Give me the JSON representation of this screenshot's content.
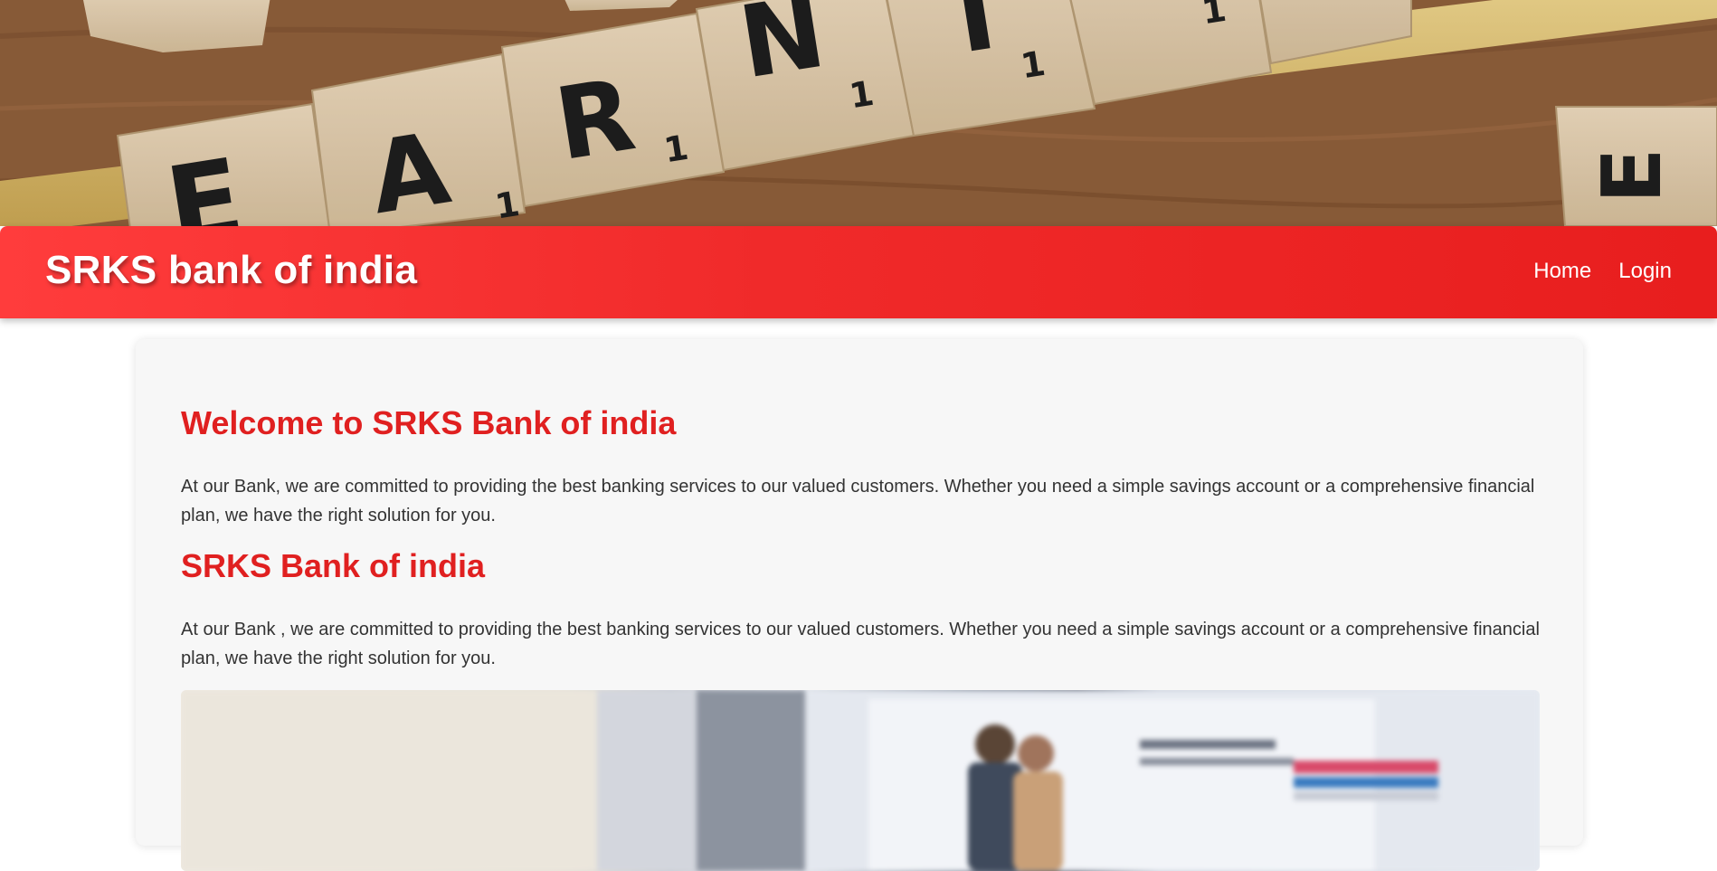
{
  "header": {
    "brand": "SRKS bank of india",
    "nav": [
      {
        "label": "Home"
      },
      {
        "label": "Login"
      }
    ]
  },
  "hero": {
    "tiles": [
      {
        "letter": "E"
      },
      {
        "letter": "A",
        "score": "1"
      },
      {
        "letter": "R",
        "score": "1"
      },
      {
        "letter": "N",
        "score": "1"
      },
      {
        "letter": "I",
        "score": "1"
      },
      {
        "letter": "",
        "score": "1"
      },
      {
        "letter": "E"
      }
    ]
  },
  "main": {
    "welcome_title": "Welcome to SRKS Bank of india",
    "welcome_text": "At our Bank, we are committed to providing the best banking services to our valued customers. Whether you need a simple savings account or a comprehensive financial plan, we have the right solution for you.",
    "bank_title": "SRKS Bank of india",
    "bank_text": "At our Bank , we are committed to providing the best banking services to our valued customers. Whether you need a simple savings account or a comprehensive financial plan, we have the right solution for you."
  },
  "colors": {
    "accent": "#e02020",
    "navbar_start": "#ff3c3c",
    "navbar_end": "#e81e1e"
  }
}
